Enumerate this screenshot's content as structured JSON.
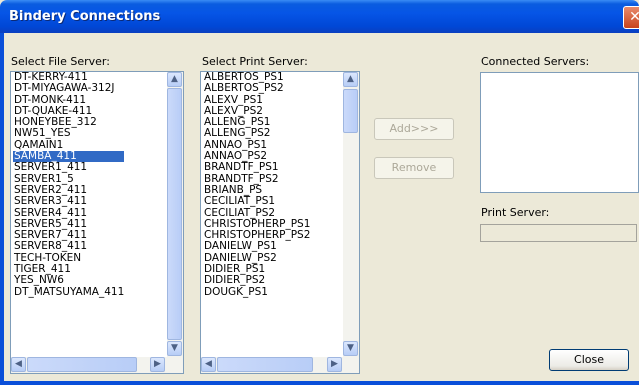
{
  "window": {
    "title": "Bindery Connections",
    "close_glyph": "✕"
  },
  "file_server": {
    "label": "Select File Server:",
    "items": [
      "DT-KERRY-411",
      "DT-MIYAGAWA-312J",
      "DT-MONK-411",
      "DT-QUAKE-411",
      "HONEYBEE_312",
      "NW51_YES",
      "QAMAIN1",
      "SAMBA_411",
      "SERVER1_411",
      "SERVER1_5",
      "SERVER2_411",
      "SERVER3_411",
      "SERVER4_411",
      "SERVER5_411",
      "SERVER7_411",
      "SERVER8_411",
      "TECH-TOKEN",
      "TIGER_411",
      "YES_NW6",
      "DT_MATSUYAMA_411"
    ],
    "selected": "SAMBA_411"
  },
  "print_server": {
    "label": "Select Print Server:",
    "items": [
      "ALBERTOS_PS1",
      "ALBERTOS_PS2",
      "ALEXV_PS1",
      "ALEXV_PS2",
      "ALLENG_PS1",
      "ALLENG_PS2",
      "ANNAO_PS1",
      "ANNAO_PS2",
      "BRANDTF_PS1",
      "BRANDTF_PS2",
      "BRIANB_PS",
      "CECILIAT_PS1",
      "CECILIAT_PS2",
      "CHRISTOPHERP_PS1",
      "CHRISTOPHERP_PS2",
      "DANIELW_PS1",
      "DANIELW_PS2",
      "DIDIER_PS1",
      "DIDIER_PS2",
      "DOUGK_PS1"
    ]
  },
  "buttons": {
    "add": "Add>>>",
    "remove": "Remove",
    "close": "Close"
  },
  "connected": {
    "label": "Connected Servers:",
    "items": []
  },
  "print_server_field": {
    "label": "Print Server:",
    "value": ""
  },
  "scroll_glyphs": {
    "up": "▲",
    "down": "▼",
    "left": "◀",
    "right": "▶"
  }
}
